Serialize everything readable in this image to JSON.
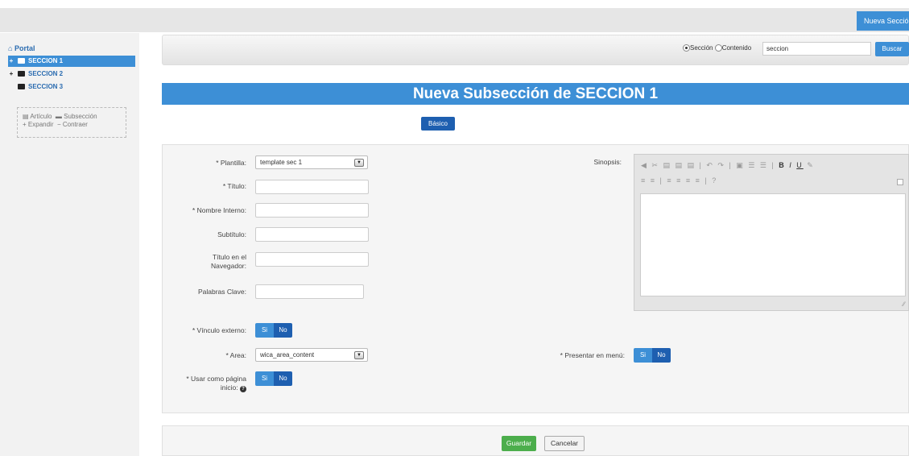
{
  "header": {
    "new_section_button": "Nueva Sección"
  },
  "sidebar": {
    "portal_label": "Portal",
    "items": [
      {
        "label": "SECCION 1"
      },
      {
        "label": "SECCION 2"
      },
      {
        "label": "SECCION 3"
      }
    ],
    "legend": {
      "articulo": "Artículo",
      "subseccion": "Subsección",
      "expandir": "Expandir",
      "contraer": "Contraer"
    }
  },
  "search": {
    "option_seccion": "Sección",
    "option_contenido": "Contenido",
    "selected": "Sección",
    "value": "seccion",
    "button": "Buscar"
  },
  "page": {
    "title": "Nueva Subsección de SECCION 1",
    "tab_basic": "Básico"
  },
  "form": {
    "plantilla_label": "* Plantilla:",
    "plantilla_value": "template sec 1",
    "titulo_label": "* Título:",
    "nombre_interno_label": "* Nombre Interno:",
    "subtitulo_label": "Subtítulo:",
    "titulo_navegador_label": "Título en el Navegador:",
    "palabras_clave_label": "Palabras Clave:",
    "vinculo_externo_label": "* Vínculo externo:",
    "area_label": "* Area:",
    "area_value": "wica_area_content",
    "usar_inicio_label": "* Usar como página inicio:",
    "sinopsis_label": "Sinopsis:",
    "presentar_menu_label": "* Presentar en menú:",
    "toggle_si": "Si",
    "toggle_no": "No"
  },
  "footer": {
    "save": "Guardar",
    "cancel": "Cancelar"
  },
  "colors": {
    "accent": "#3d8fd6",
    "accent_dark": "#1e5fb0",
    "save_green": "#4cae4c"
  }
}
